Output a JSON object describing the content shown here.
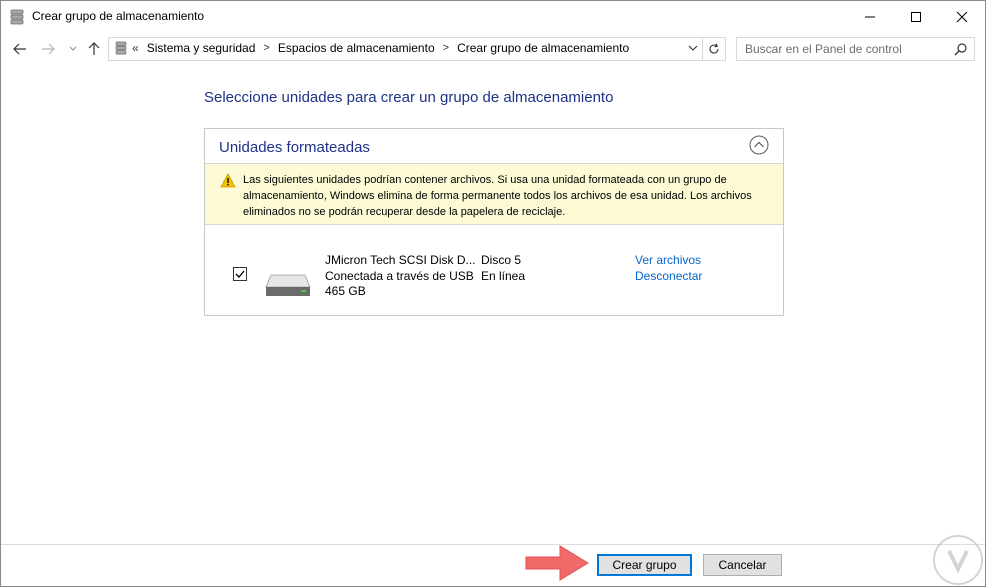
{
  "window": {
    "title": "Crear grupo de almacenamiento",
    "controls": {
      "minimize": "minimize",
      "maximize": "maximize",
      "close": "close"
    }
  },
  "navigation": {
    "breadcrumb": {
      "overflow": "«",
      "items": [
        "Sistema y seguridad",
        "Espacios de almacenamiento",
        "Crear grupo de almacenamiento"
      ]
    },
    "search": {
      "placeholder": "Buscar en el Panel de control"
    }
  },
  "main": {
    "heading": "Seleccione unidades para crear un grupo de almacenamiento",
    "panel": {
      "title": "Unidades formateadas",
      "warning": "Las siguientes unidades podrían contener archivos. Si usa una unidad formateada con un grupo de almacenamiento, Windows elimina de forma permanente todos los archivos de esa unidad. Los archivos eliminados no se podrán recuperar desde la papelera de reciclaje.",
      "drives": [
        {
          "checked": true,
          "name": "JMicron Tech SCSI Disk D...",
          "connection": "Conectada a través de USB",
          "size": "465 GB",
          "disk": "Disco 5",
          "status": "En línea",
          "links": [
            "Ver archivos",
            "Desconectar"
          ]
        }
      ]
    }
  },
  "footer": {
    "create_label": "Crear grupo",
    "cancel_label": "Cancelar"
  },
  "colors": {
    "heading": "#1e3287",
    "link": "#0066cc",
    "warning_bg": "#fdfbd6",
    "default_button_border": "#0078d7",
    "annotation_arrow": "#f06a6a"
  }
}
